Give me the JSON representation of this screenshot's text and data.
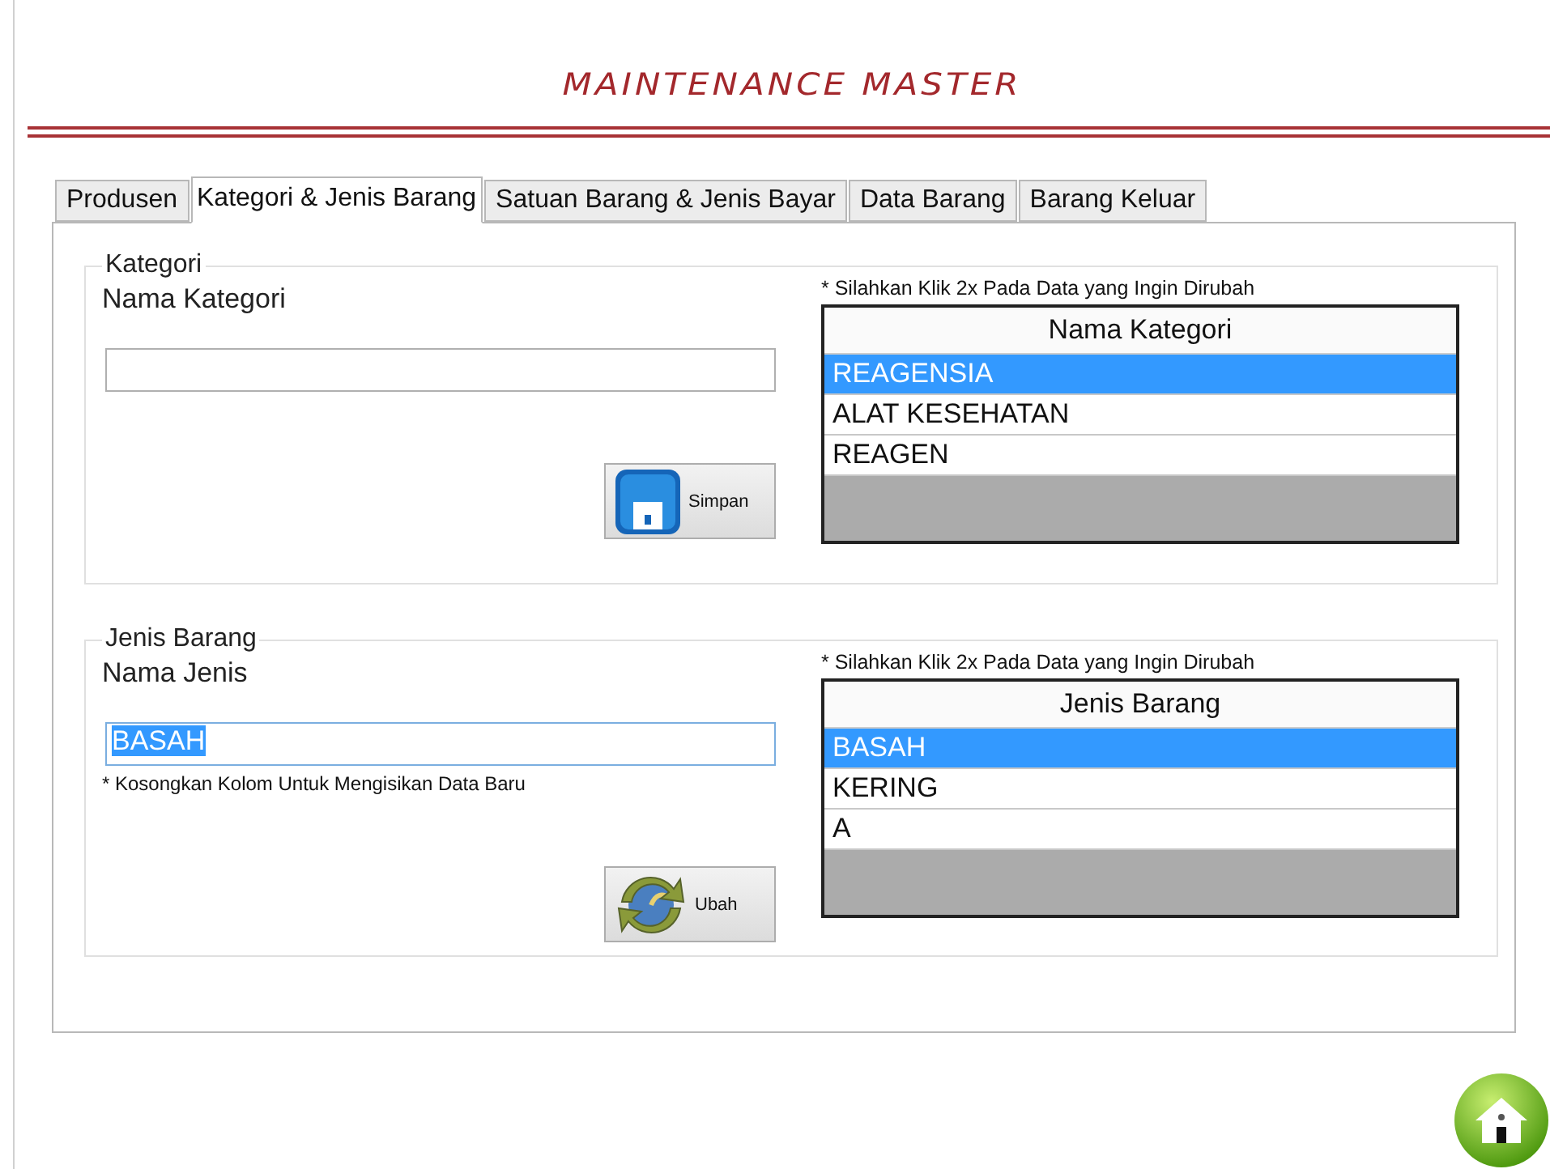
{
  "window": {
    "title": "MAINTENANCE MASTER"
  },
  "tabs": [
    {
      "label": "Produsen",
      "selected": false
    },
    {
      "label": "Kategori & Jenis Barang",
      "selected": true
    },
    {
      "label": "Satuan Barang & Jenis Bayar",
      "selected": false
    },
    {
      "label": "Data Barang",
      "selected": false
    },
    {
      "label": "Barang Keluar",
      "selected": false
    }
  ],
  "sections": [
    {
      "title": "Kategori",
      "field_label": "Nama Kategori",
      "field": {
        "focused": false
      },
      "button": {
        "label": "Simpan",
        "kind": "save"
      },
      "hint": "* Silahkan Klik 2x Pada Data yang Ingin Dirubah",
      "grid": {
        "columns": [
          "Nama Kategori"
        ],
        "rows": [
          {
            "cells": [
              "REAGENSIA"
            ],
            "selected": true
          },
          {
            "cells": [
              "ALAT KESEHATAN"
            ],
            "selected": false
          },
          {
            "cells": [
              "REAGEN"
            ],
            "selected": false
          }
        ]
      }
    },
    {
      "title": "Jenis Barang",
      "field_label": "Nama Jenis",
      "field": {
        "value": "BASAH",
        "focused": true,
        "value_selected": true
      },
      "note": "* Kosongkan Kolom Untuk Mengisikan Data Baru",
      "button": {
        "label": "Ubah",
        "kind": "refresh"
      },
      "hint": "* Silahkan Klik 2x Pada Data yang Ingin Dirubah",
      "grid": {
        "columns": [
          "Jenis Barang"
        ],
        "rows": [
          {
            "cells": [
              "BASAH"
            ],
            "selected": true
          },
          {
            "cells": [
              "KERING"
            ],
            "selected": false
          },
          {
            "cells": [
              "A"
            ],
            "selected": false
          }
        ]
      }
    }
  ]
}
